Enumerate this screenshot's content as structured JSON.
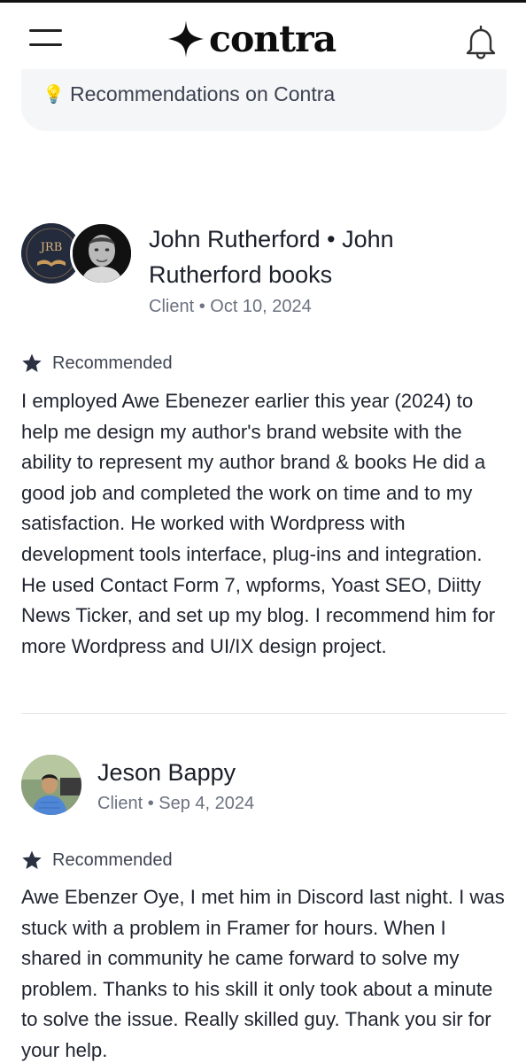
{
  "header": {
    "brand": "contra"
  },
  "banner": {
    "label": "Recommendations on Contra"
  },
  "reviews": [
    {
      "name": "John Rutherford • John Rutherford books",
      "name_line1": "John Rutherford • John",
      "name_line2": "Rutherford books",
      "avatar_logo_text": "JRB",
      "role": "Client",
      "date": "Oct 10, 2024",
      "badge": "Recommended",
      "text": "I employed Awe Ebenezer earlier this year (2024) to help me design my author's brand website with the ability to represent my author brand & books He did a good job and completed the work on time and to my satisfaction. He worked with Wordpress with development tools interface, plug-ins and integration. He used Contact Form 7, wpforms, Yoast SEO, Diitty News Ticker, and set up my blog. I recommend him for more Wordpress and UI/IX design project."
    },
    {
      "name": "Jeson Bappy",
      "role": "Client",
      "date": "Sep 4, 2024",
      "badge": "Recommended",
      "text": "Awe Ebenzer Oye, I met him in Discord last night. I was stuck with a problem in Framer for hours. When I shared in community he came forward to solve my problem. Thanks to his skill it only took about a minute to solve the issue. Really skilled guy. Thank you sir for your help."
    }
  ],
  "colors": {
    "text": "#1f2430",
    "muted": "#6b7280",
    "banner_bg": "#f5f6f8",
    "star": "#2b3142"
  },
  "icons": [
    "menu-icon",
    "contra-logo-icon",
    "bell-icon",
    "lightbulb-icon",
    "star-icon"
  ]
}
